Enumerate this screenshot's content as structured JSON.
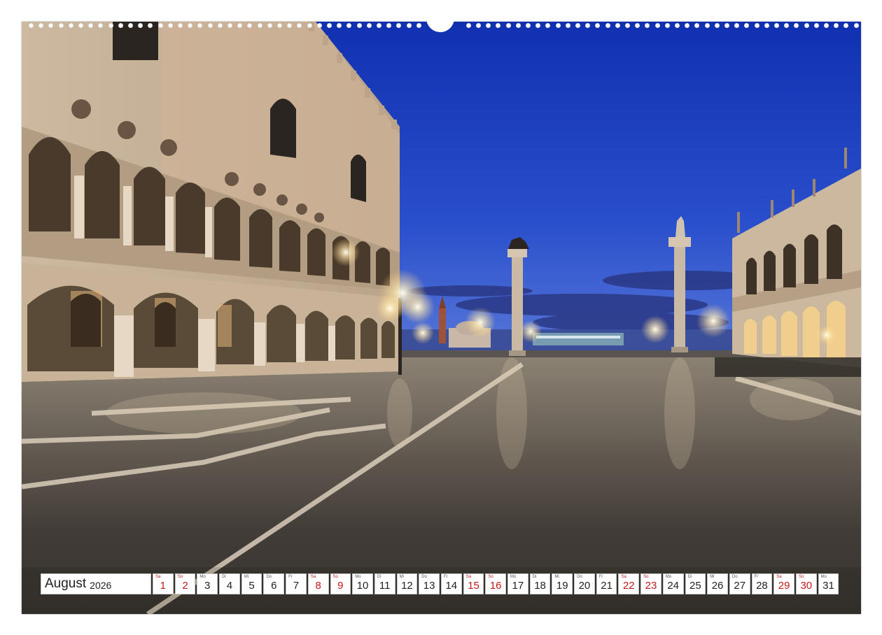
{
  "calendar": {
    "month": "August",
    "year": "2026",
    "days": [
      {
        "abbr": "Sa",
        "num": "1",
        "weekend": true
      },
      {
        "abbr": "So",
        "num": "2",
        "weekend": true
      },
      {
        "abbr": "Mo",
        "num": "3",
        "weekend": false
      },
      {
        "abbr": "Di",
        "num": "4",
        "weekend": false
      },
      {
        "abbr": "Mi",
        "num": "5",
        "weekend": false
      },
      {
        "abbr": "Do",
        "num": "6",
        "weekend": false
      },
      {
        "abbr": "Fr",
        "num": "7",
        "weekend": false
      },
      {
        "abbr": "Sa",
        "num": "8",
        "weekend": true
      },
      {
        "abbr": "So",
        "num": "9",
        "weekend": true
      },
      {
        "abbr": "Mo",
        "num": "10",
        "weekend": false
      },
      {
        "abbr": "Di",
        "num": "11",
        "weekend": false
      },
      {
        "abbr": "Mi",
        "num": "12",
        "weekend": false
      },
      {
        "abbr": "Do",
        "num": "13",
        "weekend": false
      },
      {
        "abbr": "Fr",
        "num": "14",
        "weekend": false
      },
      {
        "abbr": "Sa",
        "num": "15",
        "weekend": true
      },
      {
        "abbr": "So",
        "num": "16",
        "weekend": true
      },
      {
        "abbr": "Mo",
        "num": "17",
        "weekend": false
      },
      {
        "abbr": "Di",
        "num": "18",
        "weekend": false
      },
      {
        "abbr": "Mi",
        "num": "19",
        "weekend": false
      },
      {
        "abbr": "Do",
        "num": "20",
        "weekend": false
      },
      {
        "abbr": "Fr",
        "num": "21",
        "weekend": false
      },
      {
        "abbr": "Sa",
        "num": "22",
        "weekend": true
      },
      {
        "abbr": "So",
        "num": "23",
        "weekend": true
      },
      {
        "abbr": "Mo",
        "num": "24",
        "weekend": false
      },
      {
        "abbr": "Di",
        "num": "25",
        "weekend": false
      },
      {
        "abbr": "Mi",
        "num": "26",
        "weekend": false
      },
      {
        "abbr": "Do",
        "num": "27",
        "weekend": false
      },
      {
        "abbr": "Fr",
        "num": "28",
        "weekend": false
      },
      {
        "abbr": "Sa",
        "num": "29",
        "weekend": true
      },
      {
        "abbr": "So",
        "num": "30",
        "weekend": true
      },
      {
        "abbr": "Mo",
        "num": "31",
        "weekend": false
      }
    ]
  },
  "colors": {
    "sky_top": "#1533b8",
    "sky_bottom": "#4a6fd6",
    "pavement": "#4a4540",
    "palace_facade": "#d8c6ae",
    "lamp_glow": "#fff4d8",
    "weekend_red": "#c41a1a"
  }
}
